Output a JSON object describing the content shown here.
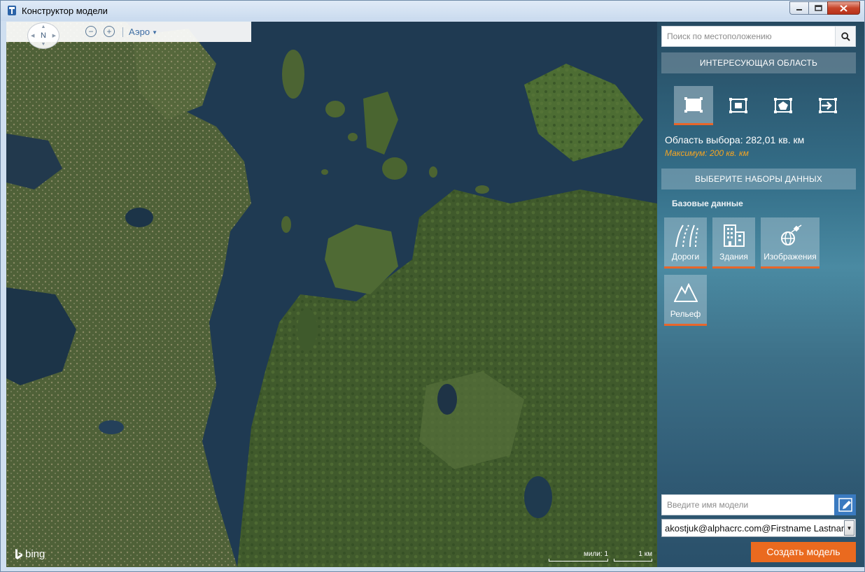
{
  "window": {
    "title": "Конструктор модели",
    "buttons": {
      "minimize_icon": "minimize-icon",
      "maximize_icon": "maximize-icon",
      "close_icon": "close-icon"
    }
  },
  "map": {
    "compass_label": "N",
    "style_label": "Аэро",
    "provider": "bing",
    "scale_miles": "мили: 1",
    "scale_km": "1 км"
  },
  "panel": {
    "search": {
      "placeholder": "Поиск по местоположению",
      "value": ""
    },
    "aoi": {
      "header": "ИНТЕРЕСУЮЩАЯ ОБЛАСТЬ",
      "tools": [
        "rectangle-select-icon",
        "fit-view-icon",
        "polygon-select-icon",
        "import-area-icon"
      ],
      "active_tool": 0,
      "area_text": "Область выбора: 282,01 кв. км",
      "max_text": "Максимум: 200 кв. км"
    },
    "datasets": {
      "header": "ВЫБЕРИТЕ НАБОРЫ ДАННЫХ",
      "base_label": "Базовые данные",
      "items": [
        {
          "label": "Дороги",
          "icon": "roads-icon"
        },
        {
          "label": "Здания",
          "icon": "buildings-icon"
        },
        {
          "label": "Изображения",
          "icon": "satellite-imagery-icon"
        },
        {
          "label": "Рельеф",
          "icon": "terrain-icon"
        }
      ]
    },
    "model_name": {
      "placeholder": "Введите имя модели",
      "value": ""
    },
    "account": {
      "value": "akostjuk@alphacrc.com@Firstname Lastname"
    },
    "create_label": "Создать модель"
  },
  "colors": {
    "accent": "#ea6a1f",
    "max_warning": "#f6a522",
    "panel": "#35708a",
    "edit_button": "#3a7ac0"
  }
}
